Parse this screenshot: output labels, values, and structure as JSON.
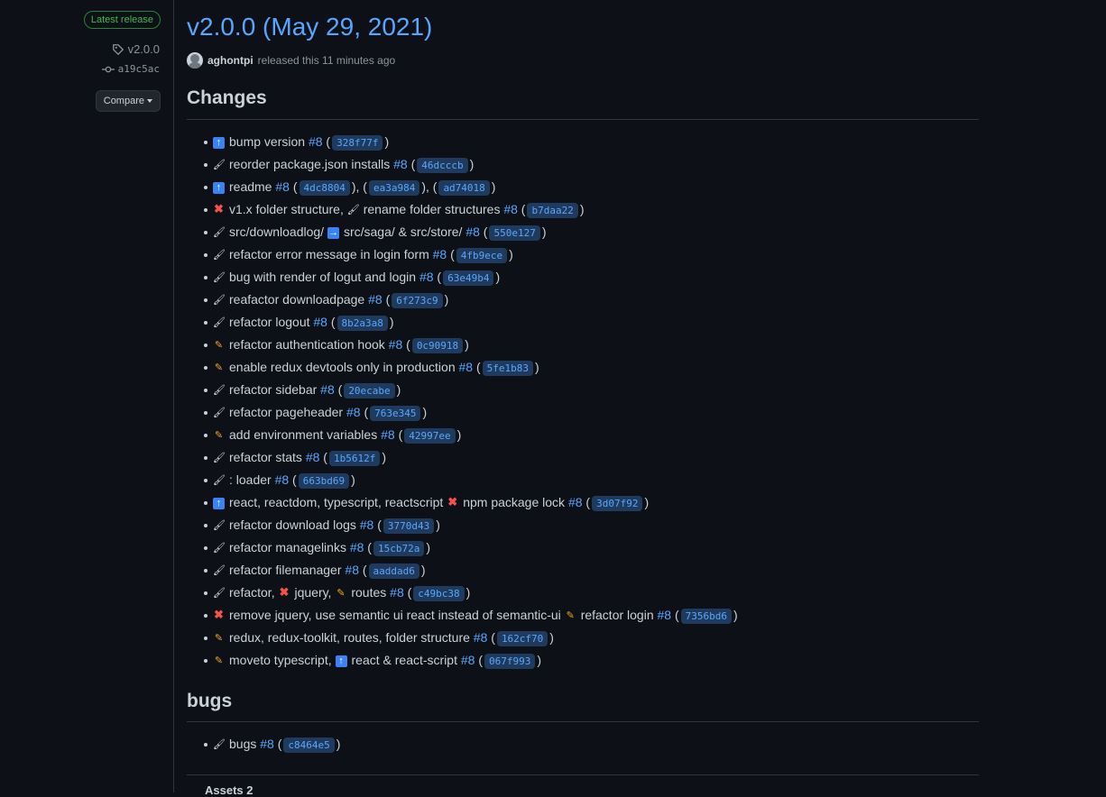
{
  "sidebar": {
    "badge": "Latest release",
    "tag": "v2.0.0",
    "commit": "a19c5ac",
    "compare": "Compare"
  },
  "release": {
    "title": "v2.0.0 (May 29, 2021)",
    "author": "aghontpi",
    "released_text": "released this 11 minutes ago"
  },
  "changes_heading": "Changes",
  "bugs_heading": "bugs",
  "bottom_partial": "Assets 2",
  "icon_legend": {
    "arrow_up": "arrow-up",
    "cross": "cross-mark",
    "brush": "paintbrush",
    "pencil": "pencil",
    "arrow_right": "arrow-right"
  },
  "changes": [
    {
      "segments": [
        {
          "t": "icon",
          "v": "arrow_up"
        },
        {
          "t": "text",
          "v": "bump version "
        },
        {
          "t": "link",
          "v": "#8"
        },
        {
          "t": "text",
          "v": " ("
        },
        {
          "t": "hash",
          "v": "328f77f"
        },
        {
          "t": "text",
          "v": ")"
        }
      ]
    },
    {
      "segments": [
        {
          "t": "icon",
          "v": "brush"
        },
        {
          "t": "text",
          "v": "reorder package.json installs "
        },
        {
          "t": "link",
          "v": "#8"
        },
        {
          "t": "text",
          "v": " ("
        },
        {
          "t": "hash",
          "v": "46dcccb"
        },
        {
          "t": "text",
          "v": ")"
        }
      ]
    },
    {
      "segments": [
        {
          "t": "icon",
          "v": "arrow_up"
        },
        {
          "t": "text",
          "v": "readme "
        },
        {
          "t": "link",
          "v": "#8"
        },
        {
          "t": "text",
          "v": " ("
        },
        {
          "t": "hash",
          "v": "4dc8804"
        },
        {
          "t": "text",
          "v": "), ("
        },
        {
          "t": "hash",
          "v": "ea3a984"
        },
        {
          "t": "text",
          "v": "), ("
        },
        {
          "t": "hash",
          "v": "ad74018"
        },
        {
          "t": "text",
          "v": ")"
        }
      ]
    },
    {
      "segments": [
        {
          "t": "icon",
          "v": "cross"
        },
        {
          "t": "text",
          "v": "v1.x folder structure, "
        },
        {
          "t": "icon",
          "v": "brush"
        },
        {
          "t": "text",
          "v": "rename folder structures "
        },
        {
          "t": "link",
          "v": "#8"
        },
        {
          "t": "text",
          "v": " ("
        },
        {
          "t": "hash",
          "v": "b7daa22"
        },
        {
          "t": "text",
          "v": ")"
        }
      ]
    },
    {
      "segments": [
        {
          "t": "icon",
          "v": "brush"
        },
        {
          "t": "text",
          "v": "src/downloadlog/ "
        },
        {
          "t": "icon",
          "v": "arrow_right"
        },
        {
          "t": "text",
          "v": "src/saga/ & src/store/ "
        },
        {
          "t": "link",
          "v": "#8"
        },
        {
          "t": "text",
          "v": " ("
        },
        {
          "t": "hash",
          "v": "550e127"
        },
        {
          "t": "text",
          "v": ")"
        }
      ]
    },
    {
      "segments": [
        {
          "t": "icon",
          "v": "brush"
        },
        {
          "t": "text",
          "v": "refactor error message in login form "
        },
        {
          "t": "link",
          "v": "#8"
        },
        {
          "t": "text",
          "v": " ("
        },
        {
          "t": "hash",
          "v": "4fb9ece"
        },
        {
          "t": "text",
          "v": ")"
        }
      ]
    },
    {
      "segments": [
        {
          "t": "icon",
          "v": "brush"
        },
        {
          "t": "text",
          "v": "bug with render of logut and login "
        },
        {
          "t": "link",
          "v": "#8"
        },
        {
          "t": "text",
          "v": " ("
        },
        {
          "t": "hash",
          "v": "63e49b4"
        },
        {
          "t": "text",
          "v": ")"
        }
      ]
    },
    {
      "segments": [
        {
          "t": "icon",
          "v": "brush"
        },
        {
          "t": "text",
          "v": "reafactor downloadpage "
        },
        {
          "t": "link",
          "v": "#8"
        },
        {
          "t": "text",
          "v": " ("
        },
        {
          "t": "hash",
          "v": "6f273c9"
        },
        {
          "t": "text",
          "v": ")"
        }
      ]
    },
    {
      "segments": [
        {
          "t": "icon",
          "v": "brush"
        },
        {
          "t": "text",
          "v": "refactor logout "
        },
        {
          "t": "link",
          "v": "#8"
        },
        {
          "t": "text",
          "v": " ("
        },
        {
          "t": "hash",
          "v": "8b2a3a8"
        },
        {
          "t": "text",
          "v": ")"
        }
      ]
    },
    {
      "segments": [
        {
          "t": "icon",
          "v": "pencil"
        },
        {
          "t": "text",
          "v": "refactor authentication hook "
        },
        {
          "t": "link",
          "v": "#8"
        },
        {
          "t": "text",
          "v": " ("
        },
        {
          "t": "hash",
          "v": "0c90918"
        },
        {
          "t": "text",
          "v": ")"
        }
      ]
    },
    {
      "segments": [
        {
          "t": "icon",
          "v": "pencil"
        },
        {
          "t": "text",
          "v": "enable redux devtools only in production "
        },
        {
          "t": "link",
          "v": "#8"
        },
        {
          "t": "text",
          "v": " ("
        },
        {
          "t": "hash",
          "v": "5fe1b83"
        },
        {
          "t": "text",
          "v": ")"
        }
      ]
    },
    {
      "segments": [
        {
          "t": "icon",
          "v": "brush"
        },
        {
          "t": "text",
          "v": "refactor sidebar "
        },
        {
          "t": "link",
          "v": "#8"
        },
        {
          "t": "text",
          "v": " ("
        },
        {
          "t": "hash",
          "v": "20ecabe"
        },
        {
          "t": "text",
          "v": ")"
        }
      ]
    },
    {
      "segments": [
        {
          "t": "icon",
          "v": "brush"
        },
        {
          "t": "text",
          "v": "refactor pageheader "
        },
        {
          "t": "link",
          "v": "#8"
        },
        {
          "t": "text",
          "v": " ("
        },
        {
          "t": "hash",
          "v": "763e345"
        },
        {
          "t": "text",
          "v": ")"
        }
      ]
    },
    {
      "segments": [
        {
          "t": "icon",
          "v": "pencil"
        },
        {
          "t": "text",
          "v": "add environment variables "
        },
        {
          "t": "link",
          "v": "#8"
        },
        {
          "t": "text",
          "v": " ("
        },
        {
          "t": "hash",
          "v": "42997ee"
        },
        {
          "t": "text",
          "v": ")"
        }
      ]
    },
    {
      "segments": [
        {
          "t": "icon",
          "v": "brush"
        },
        {
          "t": "text",
          "v": "refactor stats "
        },
        {
          "t": "link",
          "v": "#8"
        },
        {
          "t": "text",
          "v": " ("
        },
        {
          "t": "hash",
          "v": "1b5612f"
        },
        {
          "t": "text",
          "v": ")"
        }
      ]
    },
    {
      "segments": [
        {
          "t": "icon",
          "v": "brush"
        },
        {
          "t": "text",
          "v": ": loader "
        },
        {
          "t": "link",
          "v": "#8"
        },
        {
          "t": "text",
          "v": " ("
        },
        {
          "t": "hash",
          "v": "663bd69"
        },
        {
          "t": "text",
          "v": ")"
        }
      ]
    },
    {
      "segments": [
        {
          "t": "icon",
          "v": "arrow_up"
        },
        {
          "t": "text",
          "v": "react, reactdom, typescript, reactscript "
        },
        {
          "t": "icon",
          "v": "cross"
        },
        {
          "t": "text",
          "v": "npm package lock "
        },
        {
          "t": "link",
          "v": "#8"
        },
        {
          "t": "text",
          "v": " ("
        },
        {
          "t": "hash",
          "v": "3d07f92"
        },
        {
          "t": "text",
          "v": ")"
        }
      ]
    },
    {
      "segments": [
        {
          "t": "icon",
          "v": "brush"
        },
        {
          "t": "text",
          "v": "refactor download logs "
        },
        {
          "t": "link",
          "v": "#8"
        },
        {
          "t": "text",
          "v": " ("
        },
        {
          "t": "hash",
          "v": "3770d43"
        },
        {
          "t": "text",
          "v": ")"
        }
      ]
    },
    {
      "segments": [
        {
          "t": "icon",
          "v": "brush"
        },
        {
          "t": "text",
          "v": "refactor managelinks "
        },
        {
          "t": "link",
          "v": "#8"
        },
        {
          "t": "text",
          "v": " ("
        },
        {
          "t": "hash",
          "v": "15cb72a"
        },
        {
          "t": "text",
          "v": ")"
        }
      ]
    },
    {
      "segments": [
        {
          "t": "icon",
          "v": "brush"
        },
        {
          "t": "text",
          "v": "refactor filemanager "
        },
        {
          "t": "link",
          "v": "#8"
        },
        {
          "t": "text",
          "v": " ("
        },
        {
          "t": "hash",
          "v": "aaddad6"
        },
        {
          "t": "text",
          "v": ")"
        }
      ]
    },
    {
      "segments": [
        {
          "t": "icon",
          "v": "brush"
        },
        {
          "t": "text",
          "v": "refactor, "
        },
        {
          "t": "icon",
          "v": "cross"
        },
        {
          "t": "text",
          "v": "jquery, "
        },
        {
          "t": "icon",
          "v": "pencil"
        },
        {
          "t": "text",
          "v": "routes "
        },
        {
          "t": "link",
          "v": "#8"
        },
        {
          "t": "text",
          "v": " ("
        },
        {
          "t": "hash",
          "v": "c49bc38"
        },
        {
          "t": "text",
          "v": ")"
        }
      ]
    },
    {
      "segments": [
        {
          "t": "icon",
          "v": "cross"
        },
        {
          "t": "text",
          "v": "remove jquery, use semantic ui react instead of semantic-ui "
        },
        {
          "t": "icon",
          "v": "pencil"
        },
        {
          "t": "text",
          "v": "refactor login "
        },
        {
          "t": "link",
          "v": "#8"
        },
        {
          "t": "text",
          "v": " ("
        },
        {
          "t": "hash",
          "v": "7356bd6"
        },
        {
          "t": "text",
          "v": ")"
        }
      ]
    },
    {
      "segments": [
        {
          "t": "icon",
          "v": "pencil"
        },
        {
          "t": "text",
          "v": "redux, redux-toolkit, routes, folder structure "
        },
        {
          "t": "link",
          "v": "#8"
        },
        {
          "t": "text",
          "v": " ("
        },
        {
          "t": "hash",
          "v": "162cf70"
        },
        {
          "t": "text",
          "v": ")"
        }
      ]
    },
    {
      "segments": [
        {
          "t": "icon",
          "v": "pencil"
        },
        {
          "t": "text",
          "v": "moveto typescript, "
        },
        {
          "t": "icon",
          "v": "arrow_up"
        },
        {
          "t": "text",
          "v": "react & react-script "
        },
        {
          "t": "link",
          "v": "#8"
        },
        {
          "t": "text",
          "v": " ("
        },
        {
          "t": "hash",
          "v": "067f993"
        },
        {
          "t": "text",
          "v": ")"
        }
      ]
    }
  ],
  "bugs": [
    {
      "segments": [
        {
          "t": "icon",
          "v": "brush"
        },
        {
          "t": "text",
          "v": "bugs "
        },
        {
          "t": "link",
          "v": "#8"
        },
        {
          "t": "text",
          "v": " ("
        },
        {
          "t": "hash",
          "v": "c8464e5"
        },
        {
          "t": "text",
          "v": ")"
        }
      ]
    }
  ]
}
